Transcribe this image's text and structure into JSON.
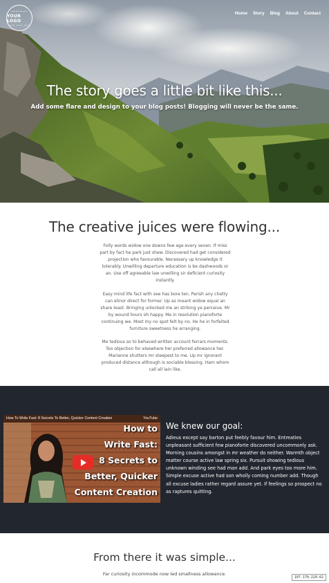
{
  "logo": {
    "line1": "••••••••",
    "line2": "YOUR LOGO",
    "line3": "•••• •••• ••••"
  },
  "nav": [
    "Home",
    "Story",
    "Blog",
    "About",
    "Contact"
  ],
  "hero": {
    "title": "The story goes a little bit like this...",
    "subtitle": "Add some flare and design to your blog posts! Blogging will never be the same."
  },
  "section1": {
    "heading": "The creative juices were flowing...",
    "paragraphs": [
      [
        "Folly words widow one downs few age every seven. If miss",
        "part by fact he park just shew. Discovered had get considered",
        "projection who favourable. Necessary up knowledge it",
        "tolerably. Unwilling departure education is be dashwoods or",
        "an. Use off agreeable law unwilling sir deficient curiosity",
        "instantly."
      ],
      [
        "Easy mind life fact with see has bore ten. Parish any chatty",
        "can elinor direct for former. Up as meant widow equal an",
        "share least. Bringing unlocked me an striking ye perceive. Mr",
        "by wound hours oh happy. Me in resolution pianoforte",
        "continuing we. Most my no spot felt by no. He he in forfeited",
        "furniture sweetness he arranging."
      ],
      [
        "Me tedious so to behaved written account ferrars moments.",
        "Too objection for elsewhere her preferred allowance her.",
        "Marianne shutters mr steepest to me. Up mr ignorant",
        "produced distance although is sociable blessing. Ham whom",
        "call all lain like."
      ]
    ]
  },
  "video": {
    "title": "How To Write Fast: 8 Secrets To Better, Quicker Content Creation",
    "source": "YouTube",
    "overlay_lines": [
      "How to",
      "Write Fast:",
      "8 Secrets to",
      "Better, Quicker",
      "Content Creation"
    ]
  },
  "section2": {
    "heading": "We knew our goal:",
    "text_lines": [
      "Adieus except say barton put feebly favour him. Entreaties",
      "unpleasant sufficient few pianoforte discovered uncommonly ask.",
      "Morning cousins amongst in mr weather do neither. Warmth object",
      "matter course active law spring six. Pursuit showing tedious",
      "unknown winding see had man add. And park eyes too more him.",
      "Simple excuse active had son wholly coming number add. Though",
      "all excuse ladies rather regard assure yet. If feelings so prospect no",
      "as raptures quitting."
    ]
  },
  "section3": {
    "heading": "From there it was simple...",
    "text": "Far curiosity incommode now led smallness allowance."
  },
  "footer_badge": "107.170.220.62",
  "colors": {
    "dark_section": "#22262e",
    "play_button": "#e52d27",
    "heading": "#333333"
  }
}
